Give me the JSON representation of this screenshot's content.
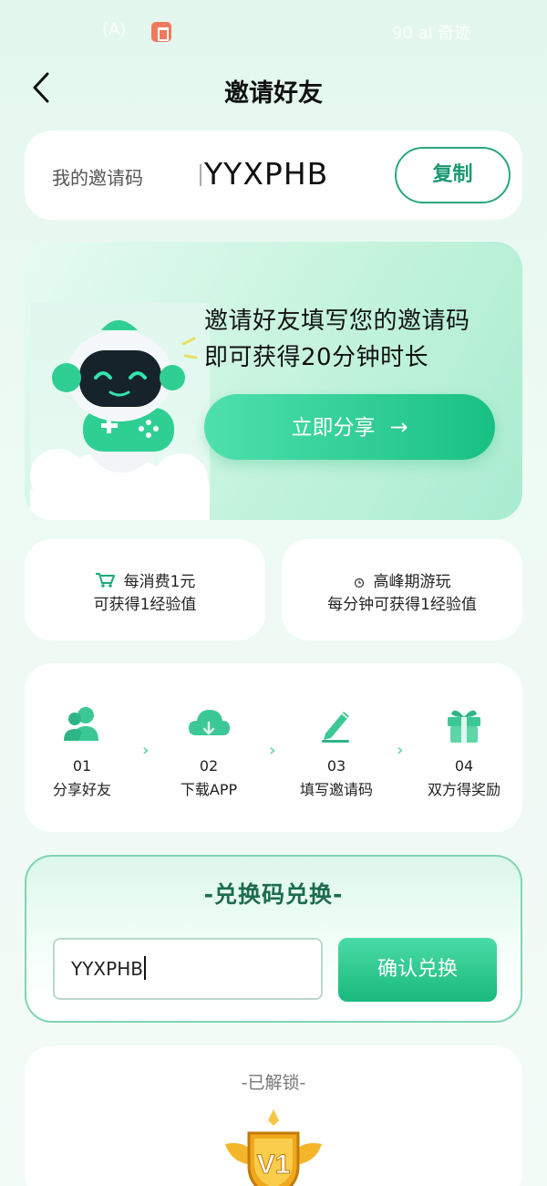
{
  "status_bar": {
    "left_text": "(A)",
    "right_text": "90 al 奇迹"
  },
  "nav": {
    "title": "邀请好友"
  },
  "invite_code": {
    "label": "我的邀请码",
    "value": "YYXPHB",
    "copy_label": "复制"
  },
  "banner": {
    "line1": "邀请好友填写您的邀请码",
    "line2": "即可获得20分钟时长",
    "share_label": "立即分享",
    "share_arrow": "→"
  },
  "info_cards": [
    {
      "icon": "cart-icon",
      "line1": "每消费1元",
      "line2": "可获得1经验值"
    },
    {
      "icon": "clock-icon",
      "line1": "高峰期游玩",
      "line2": "每分钟可获得1经验值"
    }
  ],
  "steps": [
    {
      "num": "01",
      "label": "分享好友",
      "icon": "users-icon"
    },
    {
      "num": "02",
      "label": "下载APP",
      "icon": "cloud-download-icon"
    },
    {
      "num": "03",
      "label": "填写邀请码",
      "icon": "pencil-icon"
    },
    {
      "num": "04",
      "label": "双方得奖励",
      "icon": "gift-icon"
    }
  ],
  "redeem": {
    "title": "-兑换码兑换-",
    "input_value": "YYXPHB",
    "confirm_label": "确认兑换"
  },
  "unlock": {
    "title": "-已解锁-",
    "badge_text": "V1"
  },
  "colors": {
    "accent": "#1ab97d",
    "accent_light": "#4ee0ad",
    "dark_green": "#1d6b50"
  }
}
